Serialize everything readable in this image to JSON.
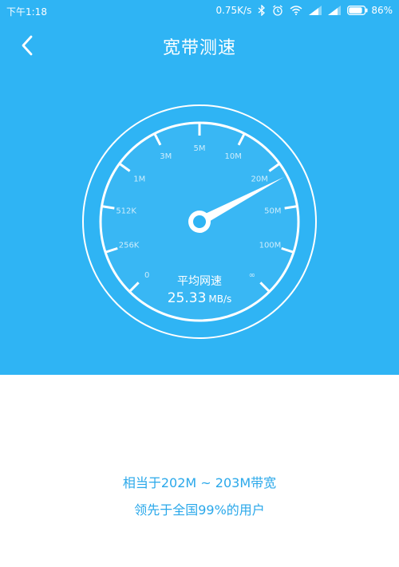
{
  "status_bar": {
    "time": "下午1:18",
    "network_speed": "0.75K/s",
    "battery": "86%",
    "battery_level": 0.86
  },
  "header": {
    "title": "宽带测速"
  },
  "gauge": {
    "tick_labels": [
      "0",
      "256K",
      "512K",
      "1M",
      "3M",
      "5M",
      "10M",
      "20M",
      "50M",
      "100M",
      "∞"
    ],
    "avg_label": "平均网速",
    "avg_value": "25.33",
    "avg_unit": "MB/s",
    "needle_position": 7.3
  },
  "result": {
    "line1": "相当于202M ~ 203M带宽",
    "line2": "领先于全国99%的用户"
  },
  "colors": {
    "background_top": "#2fb4f4",
    "accent_text": "#2aa8ea"
  }
}
